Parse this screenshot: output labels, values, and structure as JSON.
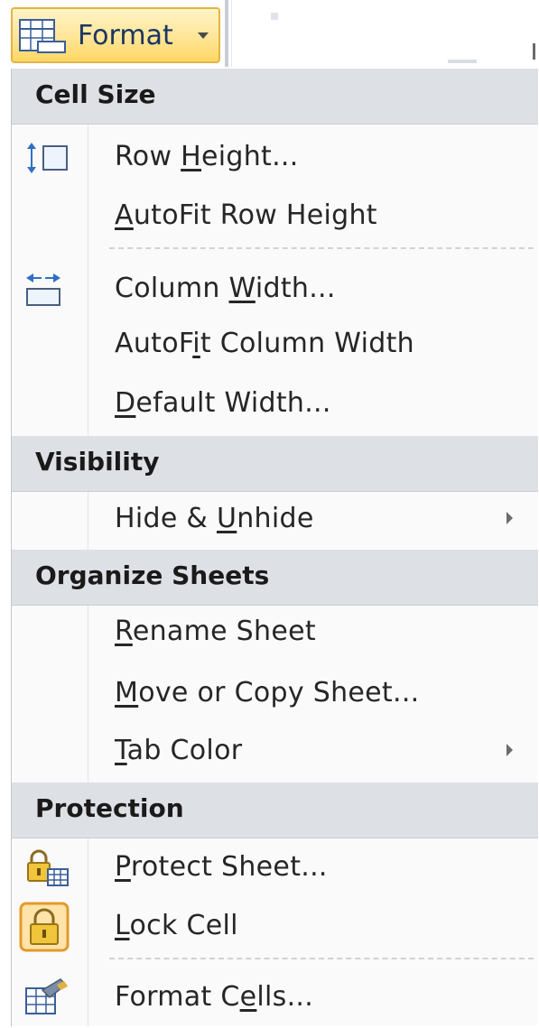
{
  "ribbon": {
    "format_button_label": "Format",
    "icons": {
      "format": "format-table-icon",
      "dropdown": "chevron-down-icon"
    }
  },
  "menu": {
    "sections": [
      {
        "header": "Cell Size",
        "items": [
          {
            "pre": "Row ",
            "key": "H",
            "post": "eight...",
            "icon": "row-height-icon"
          },
          {
            "pre": "",
            "key": "A",
            "post": "utoFit Row Height",
            "icon": ""
          },
          {
            "pre": "Column ",
            "key": "W",
            "post": "idth...",
            "icon": "column-width-icon"
          },
          {
            "pre": "AutoF",
            "key": "i",
            "post": "t Column Width",
            "icon": ""
          },
          {
            "pre": "",
            "key": "D",
            "post": "efault Width...",
            "icon": ""
          }
        ]
      },
      {
        "header": "Visibility",
        "items": [
          {
            "pre": "Hide & ",
            "key": "U",
            "post": "nhide",
            "icon": "",
            "submenu": true
          }
        ]
      },
      {
        "header": "Organize Sheets",
        "items": [
          {
            "pre": "",
            "key": "R",
            "post": "ename Sheet",
            "icon": ""
          },
          {
            "pre": "",
            "key": "M",
            "post": "ove or Copy Sheet...",
            "icon": ""
          },
          {
            "pre": "",
            "key": "T",
            "post": "ab Color",
            "icon": "",
            "submenu": true
          }
        ]
      },
      {
        "header": "Protection",
        "items": [
          {
            "pre": "",
            "key": "P",
            "post": "rotect Sheet...",
            "icon": "protect-sheet-icon"
          },
          {
            "pre": "",
            "key": "L",
            "post": "ock Cell",
            "icon": "lock-cell-icon"
          },
          {
            "pre": "Format C",
            "key": "e",
            "post": "lls...",
            "icon": "format-cells-icon"
          }
        ]
      }
    ]
  }
}
